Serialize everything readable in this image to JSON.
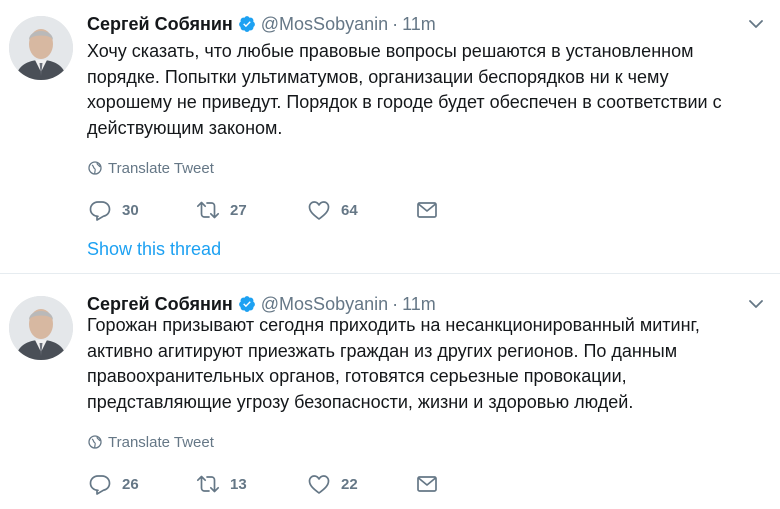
{
  "tweets": [
    {
      "author_name": "Сергей Собянин",
      "handle": "@MosSobyanin",
      "separator": "·",
      "time": "11m",
      "text": "Хочу сказать, что любые правовые вопросы решаются в установленном\nпорядке. Попытки ультиматумов, организации беспорядков ни к чему\nхорошему не приведут. Порядок в городе будет обеспечен в соответствии с\nдействующим законом.",
      "translate_label": "Translate Tweet",
      "replies": "30",
      "retweets": "27",
      "likes": "64",
      "thread_label": "Show this thread"
    },
    {
      "author_name": "Сергей Собянин",
      "handle": "@MosSobyanin",
      "separator": "·",
      "time": "11m",
      "text": "Горожан призывают сегодня приходить на несанкционированный митинг,\nактивно агитируют приезжать граждан из других регионов. По данным\nправоохранительных органов, готовятся серьезные провокации,\nпредставляющие угрозу безопасности, жизни и здоровью людей.",
      "translate_label": "Translate Tweet",
      "replies": "26",
      "retweets": "13",
      "likes": "22"
    }
  ],
  "colors": {
    "text": "#14171a",
    "secondary": "#657786",
    "link": "#1da1f2",
    "verified": "#1da1f2",
    "divider": "#e6ecf0"
  },
  "icons": [
    "verified-badge-icon",
    "chevron-down-icon",
    "globe-icon",
    "reply-icon",
    "retweet-icon",
    "like-icon",
    "direct-message-icon"
  ]
}
